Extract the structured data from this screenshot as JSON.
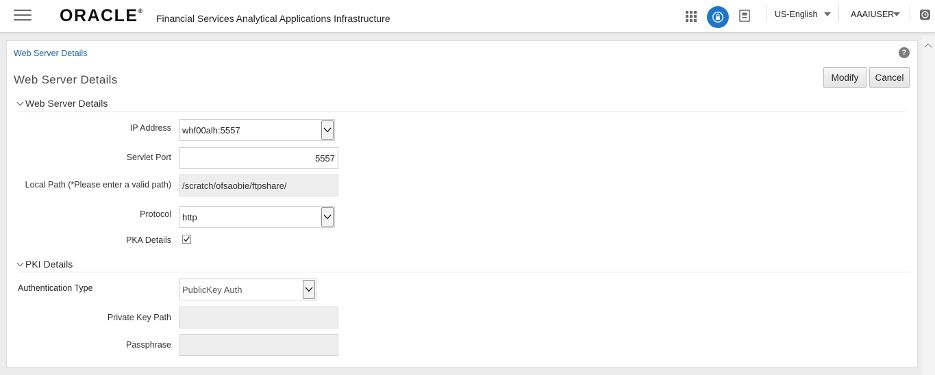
{
  "header": {
    "menu_icon": "hamburger-menu-icon",
    "logo_text": "ORACLE",
    "logo_mark": "®",
    "app_title": "Financial Services Analytical Applications Infrastructure",
    "icons": [
      "apps-grid-icon",
      "lock-icon",
      "document-icon",
      "clock-icon"
    ],
    "language": "US-English",
    "user": "AAAIUSER",
    "accent_color": "#1e76c9"
  },
  "page": {
    "breadcrumb": "Web Server Details",
    "title": "Web Server Details",
    "help_label": "?",
    "buttons": {
      "modify": "Modify",
      "cancel": "Cancel"
    }
  },
  "web_server_section": {
    "heading": "Web Server Details",
    "ip_address": {
      "label": "IP Address",
      "value": "whf00alh:5557"
    },
    "servlet_port": {
      "label": "Servlet Port",
      "value": "5557"
    },
    "local_path": {
      "label": "Local Path (*Please enter a valid path)",
      "value": "/scratch/ofsaobie/ftpshare/"
    },
    "protocol": {
      "label": "Protocol",
      "value": "http"
    },
    "pka_details": {
      "label": "PKA Details",
      "checked": true,
      "check_glyph": "✓"
    }
  },
  "pki_section": {
    "heading": "PKI Details",
    "authentication_type": {
      "label": "Authentication Type",
      "value": "PublicKey Auth"
    },
    "private_key_path": {
      "label": "Private Key Path",
      "value": ""
    },
    "passphrase": {
      "label": "Passphrase",
      "value": ""
    }
  }
}
